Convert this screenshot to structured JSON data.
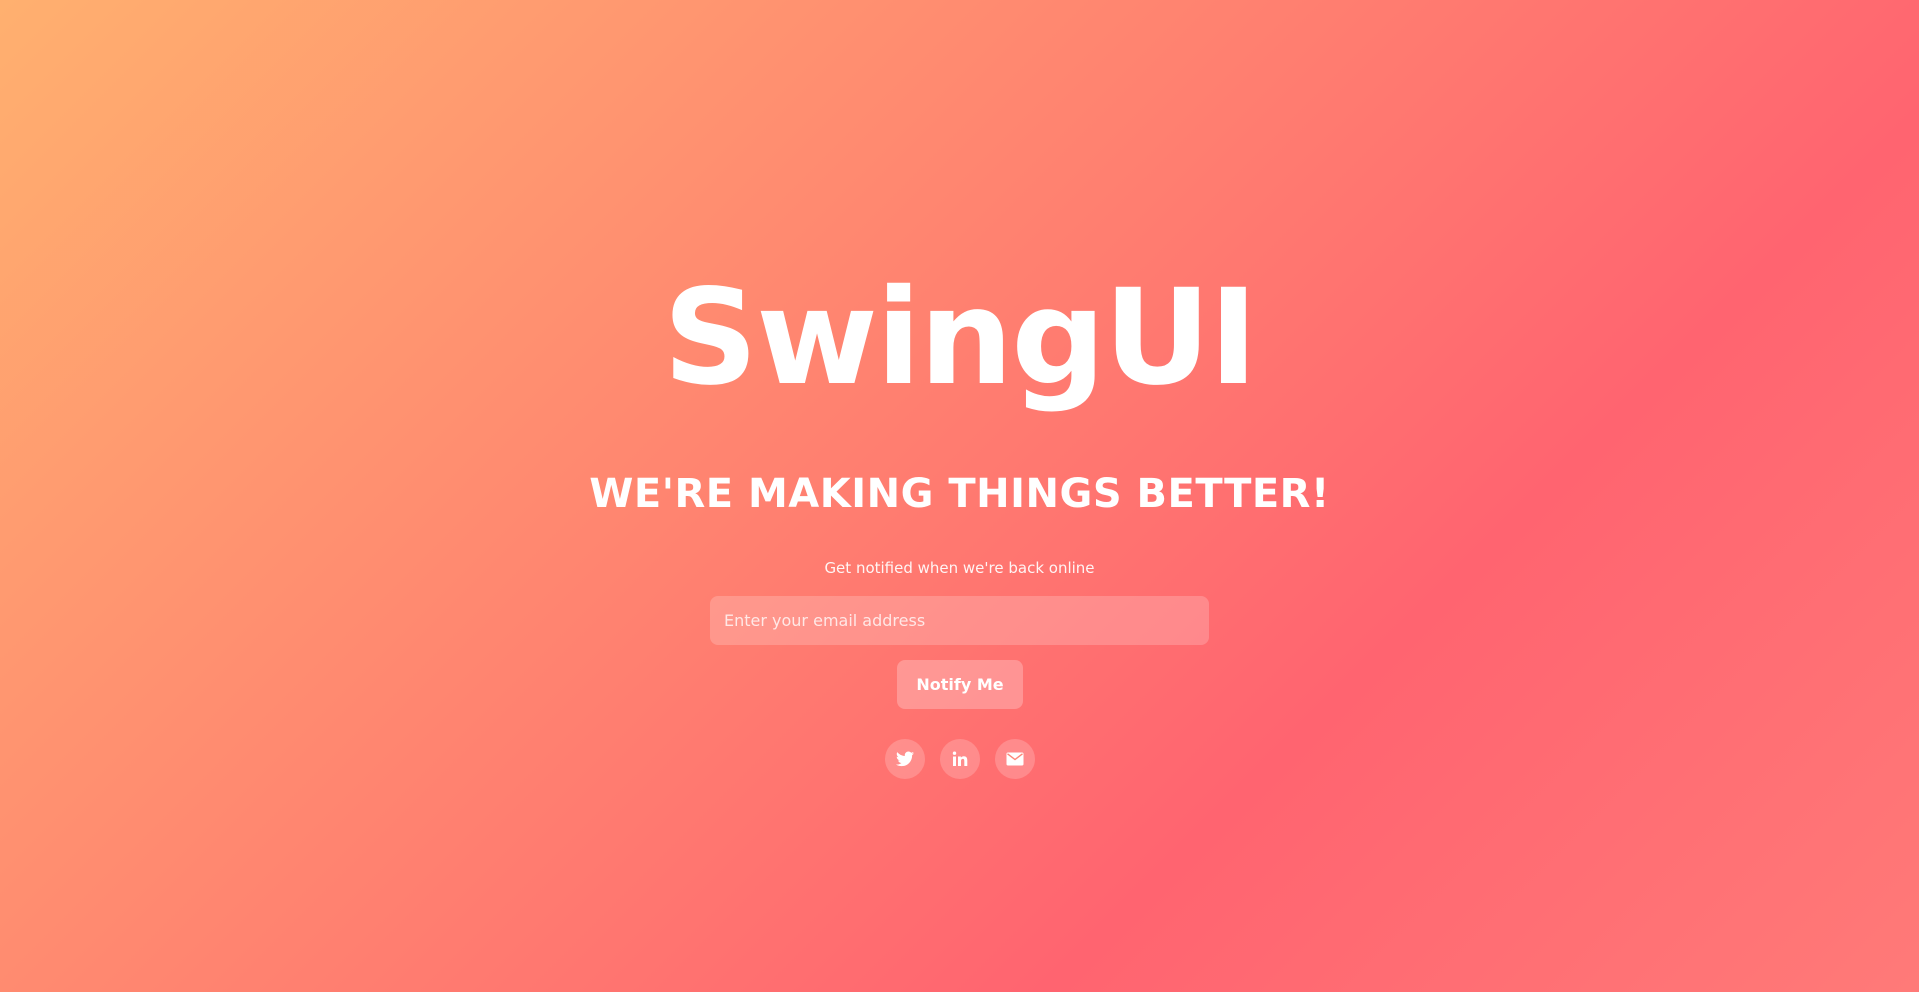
{
  "brand": {
    "logo_text": "SwingUI"
  },
  "hero": {
    "headline": "WE'RE MAKING THINGS BETTER!",
    "subtitle": "Get notified when we're back online"
  },
  "form": {
    "email_placeholder": "Enter your email address",
    "email_value": "",
    "submit_label": "Notify Me"
  },
  "social_links": [
    {
      "icon": "twitter-icon"
    },
    {
      "icon": "linkedin-icon"
    },
    {
      "icon": "email-icon"
    }
  ],
  "theme": {
    "gradient_start": "#ffb06f",
    "gradient_mid": "#ff6470",
    "text_color": "#ffffff"
  }
}
